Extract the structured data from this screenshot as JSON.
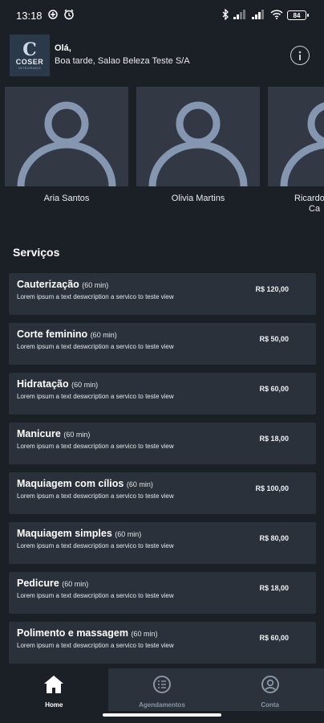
{
  "status_bar": {
    "time": "13:18",
    "battery": "84"
  },
  "header": {
    "logo": {
      "letter": "C",
      "name": "COSER",
      "subtitle": "INTEGRADO"
    },
    "greeting": "Olá,",
    "subtitle": "Boa tarde, Salao Beleza Teste S/A",
    "info_icon": "info-icon"
  },
  "professionals": [
    {
      "name": "Aria Santos"
    },
    {
      "name": "Olivia Martins"
    },
    {
      "name_line1": "Ricardo",
      "name_line2": "Ca"
    }
  ],
  "services_title": "Serviços",
  "services": [
    {
      "name": "Cauterização",
      "duration": "(60 min)",
      "description": "Lorem ipsum a text deswcription a servico to teste view",
      "price": "R$ 120,00"
    },
    {
      "name": "Corte feminino",
      "duration": "(60 min)",
      "description": "Lorem ipsum a text deswcription a servico to teste view",
      "price": "R$ 50,00"
    },
    {
      "name": "Hidratação",
      "duration": "(60 min)",
      "description": "Lorem ipsum a text deswcription a servico to teste view",
      "price": "R$ 60,00"
    },
    {
      "name": "Manicure",
      "duration": "(60 min)",
      "description": "Lorem ipsum a text deswcription a servico to teste view",
      "price": "R$ 18,00"
    },
    {
      "name": "Maquiagem com cílios",
      "duration": "(60 min)",
      "description": "Lorem ipsum a text deswcription a servico to teste view",
      "price": "R$ 100,00"
    },
    {
      "name": "Maquiagem simples",
      "duration": "(60 min)",
      "description": "Lorem ipsum a text deswcription a servico to teste view",
      "price": "R$ 80,00"
    },
    {
      "name": "Pedicure",
      "duration": "(60 min)",
      "description": "Lorem ipsum a text deswcription a servico to teste view",
      "price": "R$ 18,00"
    },
    {
      "name": "Polimento e massagem",
      "duration": "(60 min)",
      "description": "Lorem ipsum a text deswcription a servico to teste view",
      "price": "R$ 60,00"
    }
  ],
  "bottom_nav": [
    {
      "label": "Home",
      "icon": "home-icon",
      "active": true
    },
    {
      "label": "Agendamentos",
      "icon": "list-icon",
      "active": false
    },
    {
      "label": "Conta",
      "icon": "account-icon",
      "active": false
    }
  ],
  "colors": {
    "background": "#1b2027",
    "card": "#2b313a",
    "avatar_bg": "#323945",
    "avatar_fg": "#8596b0",
    "nav_inactive": "#2b323c"
  }
}
